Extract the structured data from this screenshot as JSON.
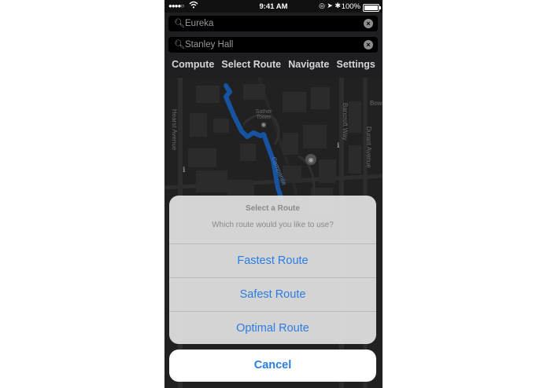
{
  "status_bar": {
    "signal": "●●●●○",
    "wifi": "wifi-icon",
    "time": "9:41 AM",
    "icons": "◎ ➤ ✱",
    "battery_percent": "100%"
  },
  "search": {
    "origin_value": "Eureka",
    "destination_value": "Stanley Hall"
  },
  "tabs": [
    "Compute",
    "Select Route",
    "Navigate",
    "Settings"
  ],
  "map": {
    "labels": {
      "bow": "Bow",
      "sather": "Sather",
      "tower": "Tower",
      "bancroft": "Bancroft Way",
      "durant": "Durant Avenue",
      "hearst": "Hearst Avenue",
      "campanile": "Campanile"
    },
    "route_color": "#1f6fd6"
  },
  "action_sheet": {
    "title": "Select a Route",
    "message": "Which route would you like to use?",
    "options": [
      "Fastest Route",
      "Safest Route",
      "Optimal Route"
    ],
    "cancel": "Cancel",
    "accent_color": "#2a7de1"
  }
}
